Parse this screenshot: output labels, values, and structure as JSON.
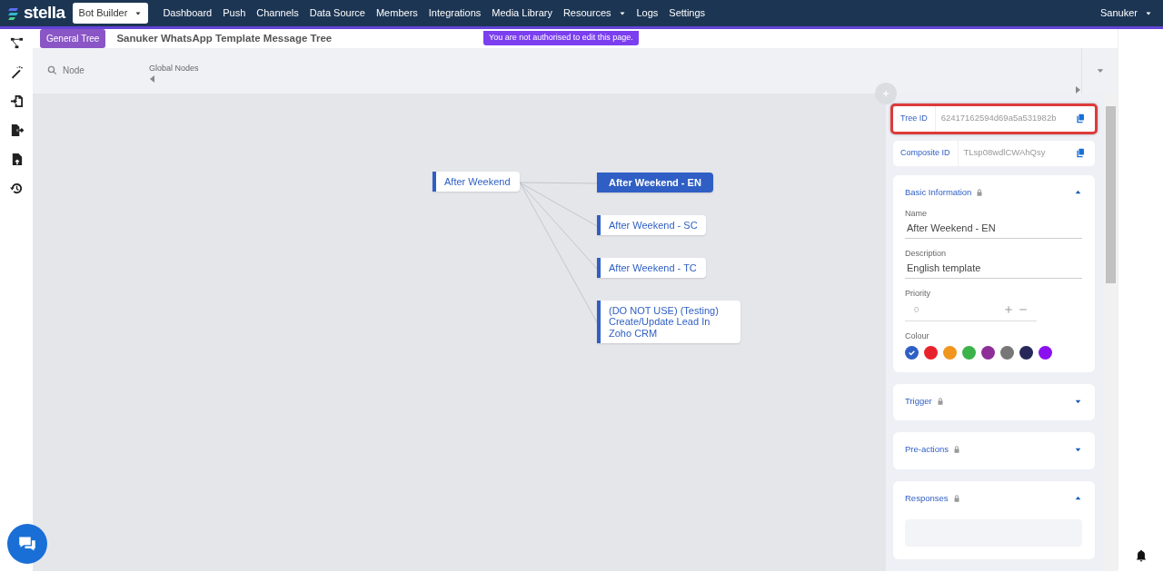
{
  "navbar": {
    "logo": "stella",
    "module": "Bot Builder",
    "menu": [
      {
        "label": "Dashboard",
        "kind": "link"
      },
      {
        "label": "Push",
        "kind": "link"
      },
      {
        "label": "Channels",
        "kind": "link"
      },
      {
        "label": "Data Source",
        "kind": "link"
      },
      {
        "label": "Members",
        "kind": "link"
      },
      {
        "label": "Integrations",
        "kind": "link"
      },
      {
        "label": "Media Library",
        "kind": "link"
      },
      {
        "label": "Resources",
        "kind": "dropdown"
      },
      {
        "label": "Logs",
        "kind": "link"
      },
      {
        "label": "Settings",
        "kind": "link"
      }
    ],
    "user": "Sanuker"
  },
  "notice": "You are not authorised to edit this page.",
  "header": {
    "badge": "General Tree",
    "title": "Sanuker WhatsApp Template Message Tree"
  },
  "toolbar": {
    "search": {
      "placeholder": "Node"
    },
    "global_nodes": "Global Nodes"
  },
  "tree": {
    "label": "After Weekend",
    "selected": false,
    "children": [
      {
        "label": "After Weekend - EN",
        "selected": true
      },
      {
        "label": "After Weekend - SC",
        "selected": false
      },
      {
        "label": "After Weekend - TC",
        "selected": false
      },
      {
        "label": "(DO NOT USE) (Testing) Create/Update Lead In Zoho CRM",
        "selected": false
      }
    ]
  },
  "panel": {
    "ids": [
      {
        "label": "Tree ID",
        "value": "62417162594d69a5a531982b",
        "highlighted": true
      },
      {
        "label": "Composite ID",
        "value": "TLsp08wdlCWAhQsy",
        "highlighted": false
      }
    ],
    "sections": [
      {
        "title": "Basic Information",
        "locked": true,
        "expanded": true,
        "fields": [
          {
            "label": "Name",
            "value": "After Weekend - EN",
            "kind": "text"
          },
          {
            "label": "Description",
            "value": "English template",
            "kind": "text"
          },
          {
            "label": "Priority",
            "placeholder": "0",
            "kind": "stepper"
          }
        ],
        "colour": {
          "label": "Colour",
          "options": [
            {
              "color": "#2f5fc4",
              "selected": true
            },
            {
              "color": "#e8222b",
              "selected": false
            },
            {
              "color": "#f0961e",
              "selected": false
            },
            {
              "color": "#3bb34a",
              "selected": false
            },
            {
              "color": "#8e2e98",
              "selected": false
            },
            {
              "color": "#777777",
              "selected": false
            },
            {
              "color": "#27275a",
              "selected": false
            },
            {
              "color": "#8a10f0",
              "selected": false
            }
          ]
        }
      },
      {
        "title": "Trigger",
        "locked": true,
        "expanded": false
      },
      {
        "title": "Pre-actions",
        "locked": true,
        "expanded": false
      },
      {
        "title": "Responses",
        "locked": true,
        "expanded": true
      }
    ]
  }
}
